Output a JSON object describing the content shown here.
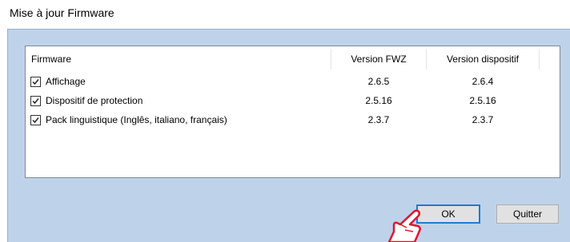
{
  "window": {
    "title": "Mise à jour Firmware"
  },
  "list": {
    "columns": {
      "firmware": "Firmware",
      "version_fwz": "Version FWZ",
      "version_device": "Version dispositif"
    },
    "rows": [
      {
        "checked": true,
        "name": "Affichage",
        "fwz": "2.6.5",
        "device": "2.6.4"
      },
      {
        "checked": true,
        "name": "Dispositif de protection",
        "fwz": "2.5.16",
        "device": "2.5.16"
      },
      {
        "checked": true,
        "name": "Pack linguistique (Inglês, italiano, français)",
        "fwz": "2.3.7",
        "device": "2.3.7"
      }
    ]
  },
  "buttons": {
    "ok": "OK",
    "quit": "Quitter"
  },
  "colors": {
    "client_bg": "#bed3ea",
    "default_button_border": "#2378d8",
    "pointer": "#e3142c"
  }
}
